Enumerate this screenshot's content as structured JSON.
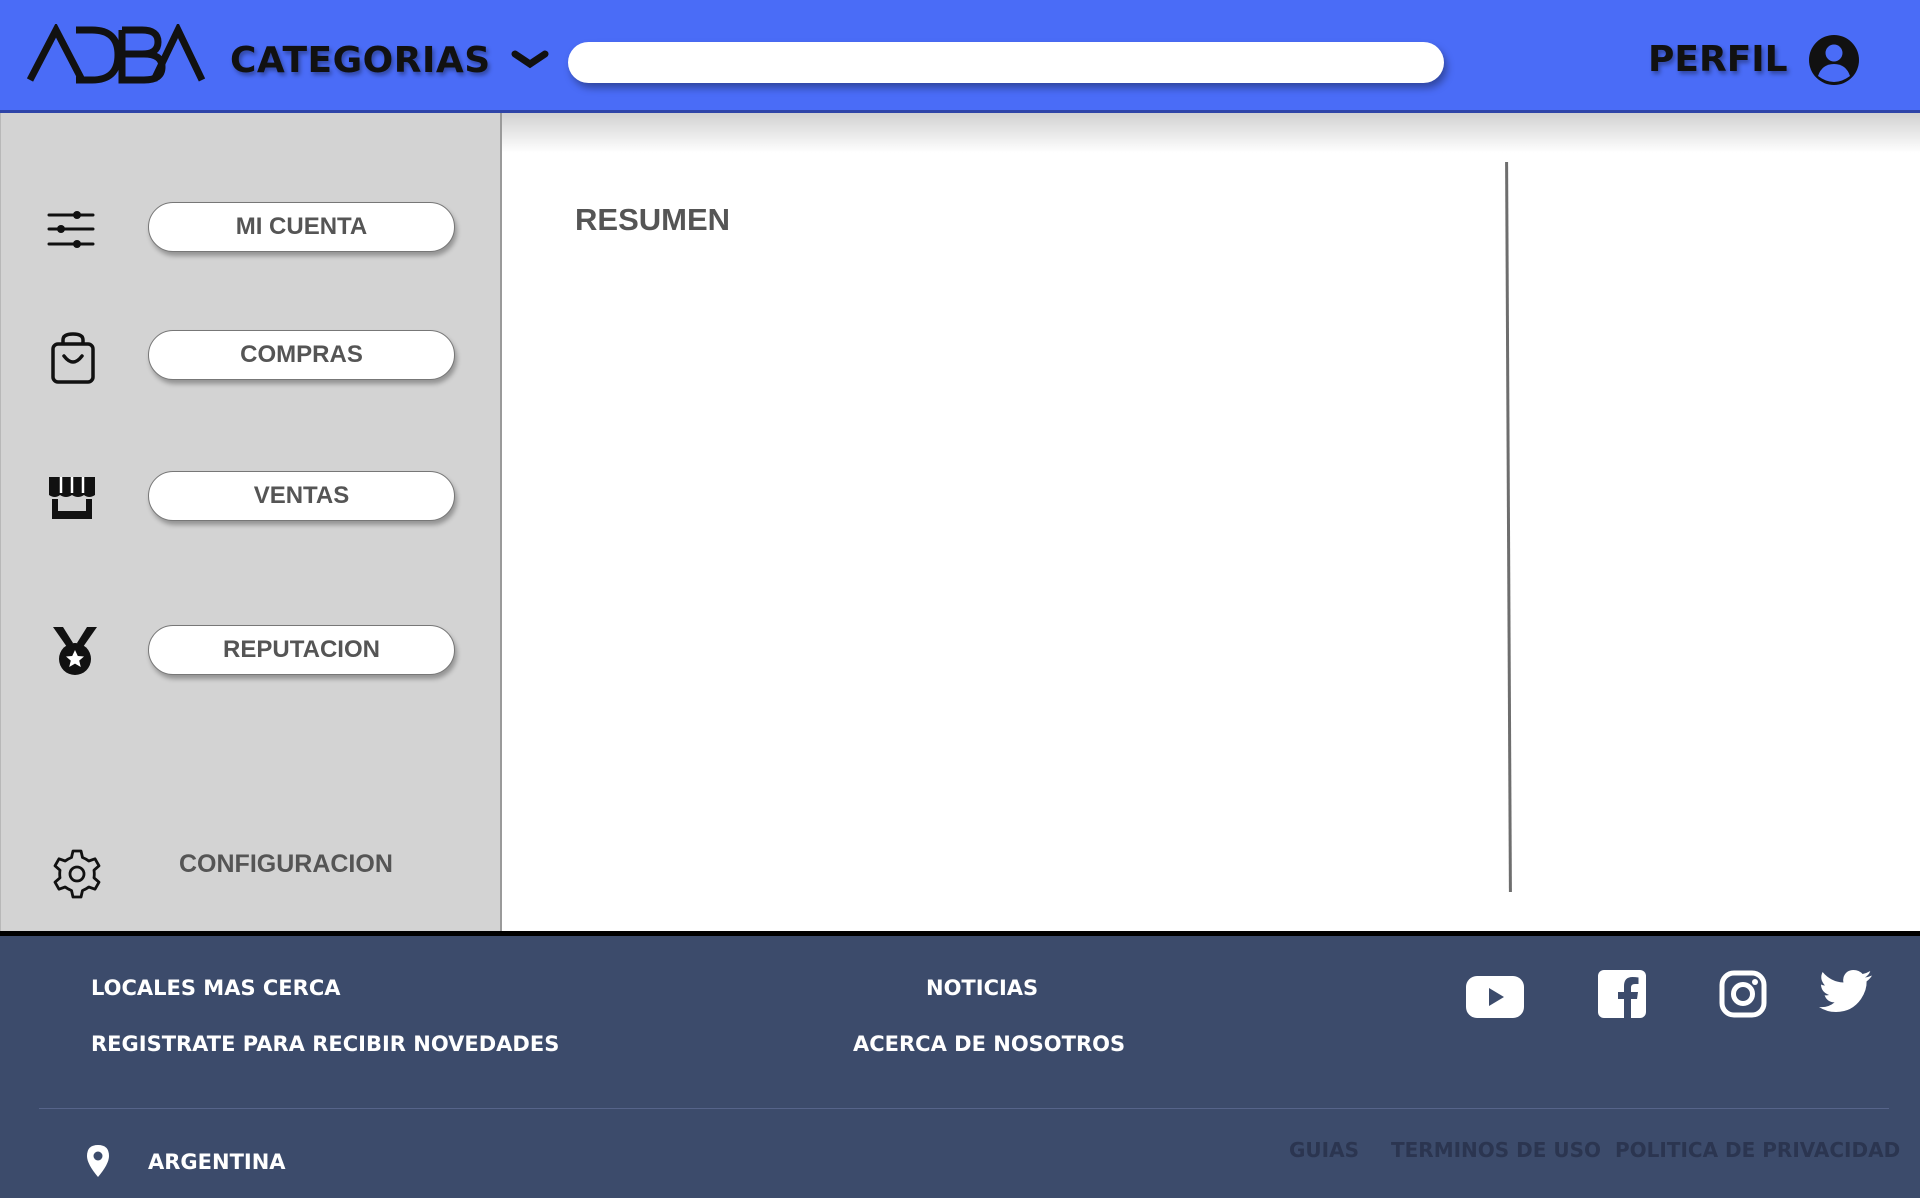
{
  "header": {
    "logo_text": "ADBA",
    "categories_label": "CATEGORIAS",
    "search_placeholder": "",
    "profile_label": "PERFIL"
  },
  "sidebar": {
    "items": [
      {
        "label": "MI CUENTA",
        "icon": "sliders-icon"
      },
      {
        "label": "COMPRAS",
        "icon": "shopping-bag-icon"
      },
      {
        "label": "VENTAS",
        "icon": "store-icon"
      },
      {
        "label": "REPUTACION",
        "icon": "medal-icon"
      }
    ],
    "settings_label": "CONFIGURACION"
  },
  "main": {
    "section_title": "RESUMEN"
  },
  "footer": {
    "links_left": [
      "LOCALES MAS CERCA",
      "REGISTRATE PARA RECIBIR NOVEDADES"
    ],
    "links_center": [
      "NOTICIAS",
      "ACERCA DE NOSOTROS"
    ],
    "social": [
      "youtube-icon",
      "facebook-icon",
      "instagram-icon",
      "twitter-icon"
    ],
    "location": "ARGENTINA",
    "legal": [
      "GUIAS",
      "TERMINOS DE USO",
      "POLITICA DE PRIVACIDAD"
    ]
  },
  "colors": {
    "header_bg": "#4a6cf7",
    "sidebar_bg": "#d3d3d3",
    "footer_bg": "#3c4b6b"
  }
}
